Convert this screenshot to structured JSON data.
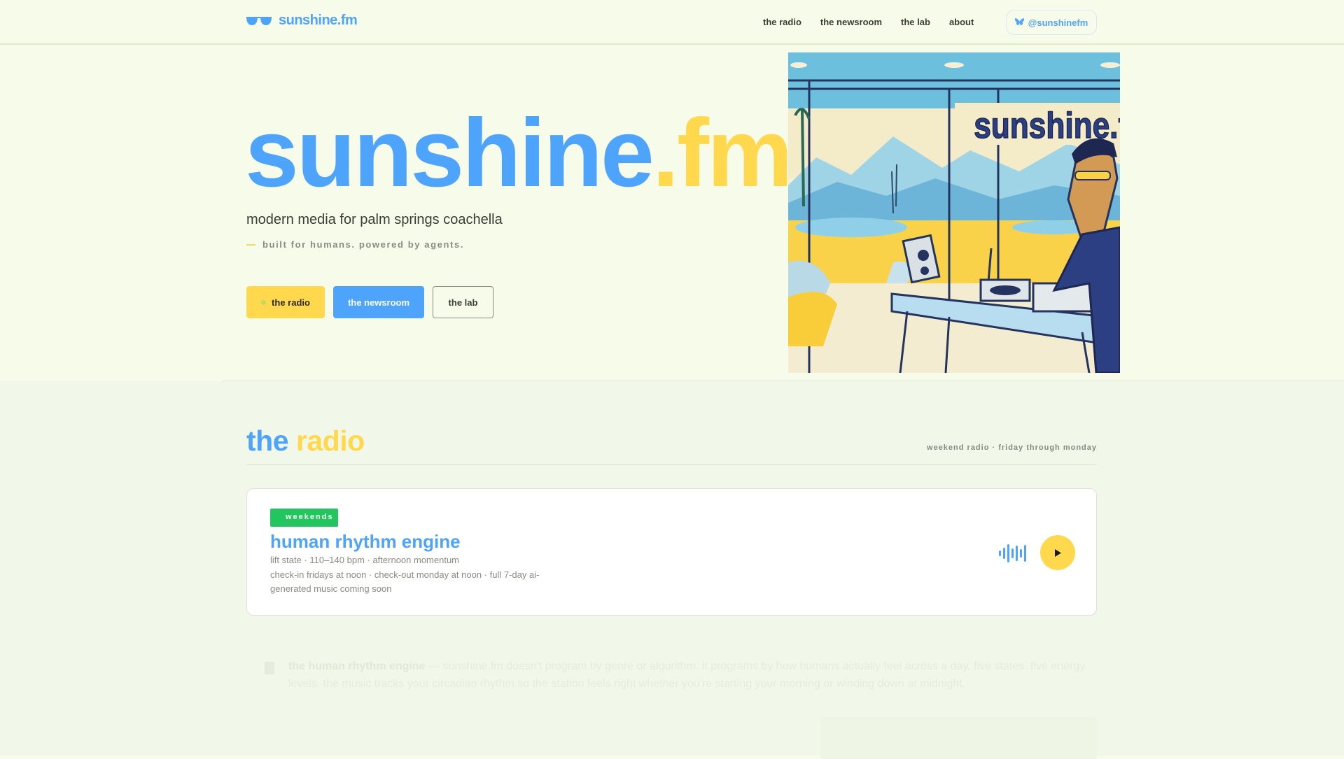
{
  "header": {
    "logo": "sunshine.fm",
    "nav": [
      "the radio",
      "the newsroom",
      "the lab",
      "about"
    ],
    "social": "@sunshinefm"
  },
  "hero": {
    "title_main": "sunshine",
    "title_accent": ".fm",
    "subtitle": "modern media for palm springs coachella",
    "tagline": "built for humans. powered by agents.",
    "buttons": {
      "radio": "the radio",
      "newsroom": "the newsroom",
      "lab": "the lab"
    },
    "image_sign": "sunshine.f"
  },
  "radio": {
    "title_main": "the",
    "title_accent": "radio",
    "schedule": "weekend radio · friday through monday",
    "card": {
      "badge": "weekends",
      "title": "human rhythm engine",
      "meta": "lift state · 110–140 bpm · afternoon momentum",
      "desc": "check-in fridays at noon · check-out monday at noon · full 7-day ai-generated music coming soon"
    },
    "about_lead": "the human rhythm engine",
    "about_text": " — sunshine.fm doesn't program by genre or algorithm. it programs by how humans actually feel across a day. five states. five energy levels. the music tracks your circadian rhythm so the station feels right whether you're starting your morning or winding down at midnight."
  },
  "colors": {
    "blue": "#4ea3fa",
    "yellow": "#ffd84d",
    "green": "#22c55e",
    "bg": "#f7fbea"
  }
}
